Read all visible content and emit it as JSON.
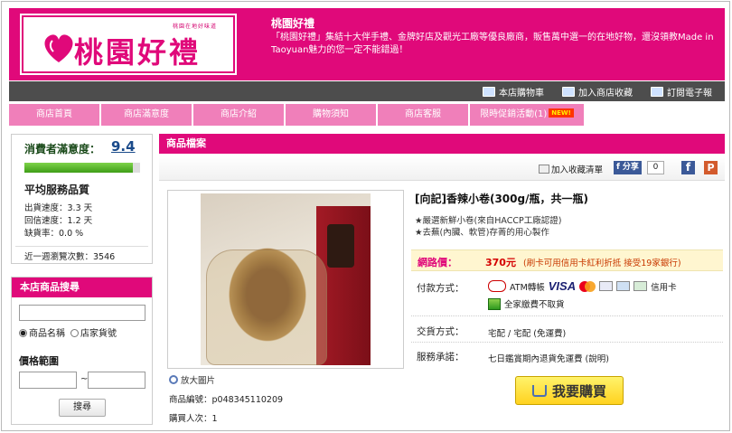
{
  "header": {
    "logo_small": "桃園在地好味道",
    "logo_text": "桃園好禮",
    "store_title": "桃園好禮",
    "store_desc": "「桃園好禮」集結十大伴手禮、金牌好店及觀光工廠等優良廠商，販售萬中選一的在地好物，還沒領教Made in Taoyuan魅力的您一定不能錯過！"
  },
  "topbar": {
    "links": [
      {
        "label": "本店購物車",
        "icon": "cart-icon"
      },
      {
        "label": "加入商店收藏",
        "icon": "bookmark-icon"
      },
      {
        "label": "訂閱電子報",
        "icon": "mail-icon"
      }
    ]
  },
  "nav": {
    "items": [
      "商店首頁",
      "商店滿意度",
      "商店介紹",
      "購物須知",
      "商店客服",
      "限時促銷活動(1)"
    ],
    "new_badge": "NEW!"
  },
  "sidebar": {
    "satisfaction_label": "消費者滿意度：",
    "satisfaction_score": "9.4",
    "satisfaction_level": 0.94,
    "service_title": "平均服務品質",
    "service_rows": [
      "出貨速度：3.3 天",
      "回信速度：1.2 天",
      "缺貨率：0.0 %"
    ],
    "weekly_visits": "近一週瀏覽次數：3546"
  },
  "search": {
    "title": "本店商品搜尋",
    "radio_name": "商品名稱",
    "radio_sku": "店家貨號",
    "price_range": "價格範圍",
    "tilde": "~",
    "button": "搜尋"
  },
  "main": {
    "section_title": "商品檔案",
    "add_favorite": "加入收藏清單",
    "fb_share": "分享",
    "fb_count": "0",
    "zoom_label": "放大圖片",
    "product_code": "商品編號：p048345110209",
    "buyer_count": "購買人次：1"
  },
  "product": {
    "title": "[向記]香辣小卷(300g/瓶，共一瓶)",
    "desc": [
      "★嚴選新鮮小卷(來自HACCP工廠認證)",
      "★去蕪(內臟、軟管)存菁的用心製作"
    ],
    "price_label": "網路價：",
    "price_value": "370元",
    "price_note": "(刷卡可用信用卡紅利折抵 接受19家銀行)",
    "payment_label": "付款方式：",
    "atm_label": "ATM轉帳",
    "visa": "VISA",
    "credit_label": "信用卡",
    "ezpay_label": "全家繳費不取貨",
    "delivery_label": "交貨方式：",
    "delivery_value": "宅配 / 宅配 (免運費)",
    "promise_label": "服務承諾：",
    "promise_value": "七日鑑賞期內退貨免運費 (說明)",
    "buy_button": "我要購買"
  },
  "colors": {
    "brand_pink": "#e0097a",
    "nav_pink": "#f07fba",
    "topbar_grey": "#4d4d4d"
  }
}
